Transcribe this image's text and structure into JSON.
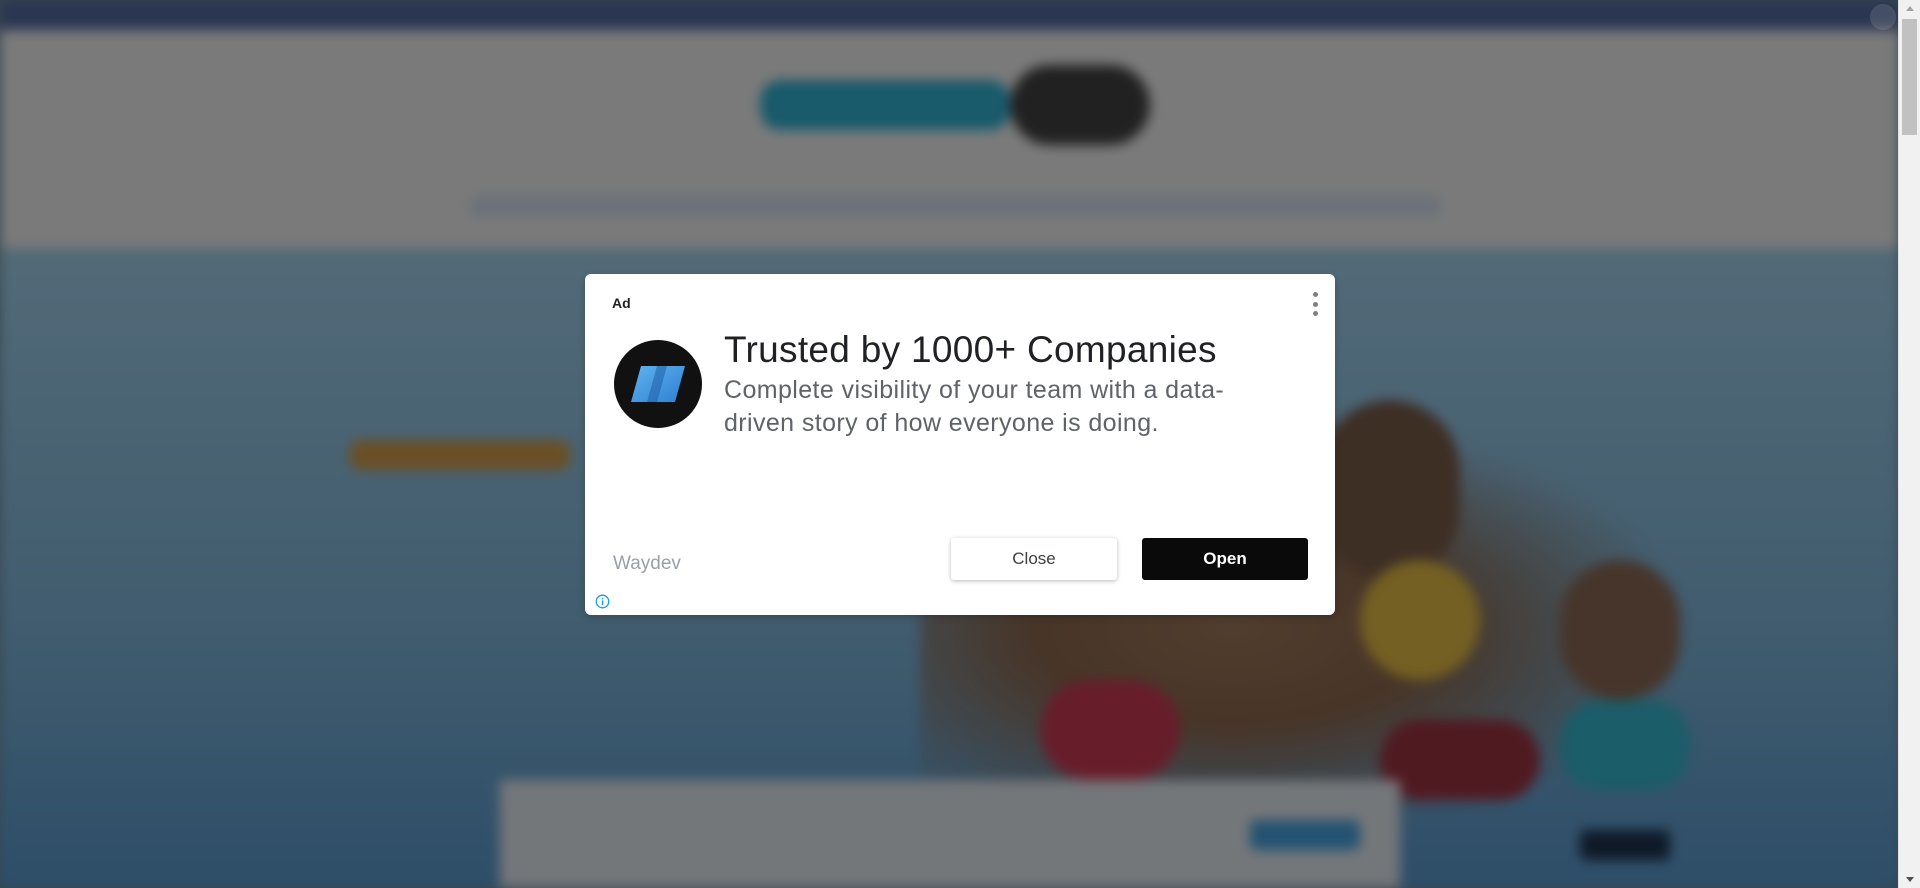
{
  "ad": {
    "label": "Ad",
    "headline": "Trusted by 1000+ Companies",
    "body": "Complete visibility of your team with a data-driven story of how everyone is doing.",
    "advertiser": "Waydev",
    "close_label": "Close",
    "open_label": "Open",
    "logo_icon": "waydev-logo-icon",
    "menu_icon": "more-vert-icon",
    "info_icon": "ad-info-icon"
  },
  "colors": {
    "overlay": "#000000",
    "dialog_bg": "#ffffff",
    "open_button": "#0a0a0a",
    "logo_bg": "#111111",
    "logo_mark": "#3b8fd9",
    "info_icon": "#1aa0d8"
  }
}
